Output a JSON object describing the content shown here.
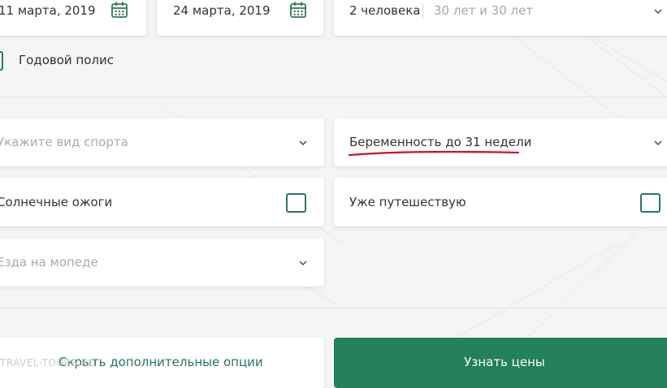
{
  "dates": {
    "start_date": "11 марта, 2019",
    "end_date": "24 марта, 2019"
  },
  "travelers": {
    "count_label": "2 человека",
    "ages_label": "30 лет и 30 лет"
  },
  "annual_policy": {
    "label": "Годовой полис"
  },
  "options": {
    "sport_placeholder": "Укажите вид спорта",
    "pregnancy_value": "Беременность до 31 недели",
    "sunburn_label": "Солнечные ожоги",
    "already_traveling_label": "Уже путешествую",
    "moped_placeholder": "Езда на мопеде"
  },
  "actions": {
    "hide_options_label": "Скрыть дополнительные опции",
    "get_prices_label": "Узнать цены"
  },
  "watermark": {
    "text": "TRAVEL-TOURS.RU"
  },
  "colors": {
    "accent_green": "#24805a",
    "checkbox_border": "#2b7a56",
    "annotation_red": "#c8102e"
  },
  "icons": {
    "calendar": "calendar-icon",
    "chevron": "chevron-down-icon"
  }
}
